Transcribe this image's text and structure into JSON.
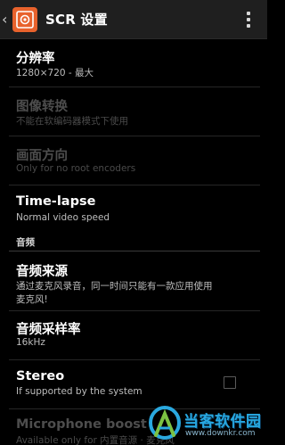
{
  "actionbar": {
    "back_glyph": "‹",
    "title": "SCR 设置",
    "icon": "screen-recorder-app-icon",
    "menu_icon": "overflow-menu-icon"
  },
  "prefs": {
    "resolution": {
      "title": "分辨率",
      "summary": "1280×720 - 最大"
    },
    "image_transform": {
      "title": "图像转换",
      "summary": "不能在软编码器模式下使用"
    },
    "orientation": {
      "title": "画面方向",
      "summary": "Only for no root encoders"
    },
    "timelapse": {
      "title": "Time-lapse",
      "summary": "Normal video speed"
    }
  },
  "audio_category": {
    "label": "音频"
  },
  "audio_prefs": {
    "source": {
      "title": "音频来源",
      "summary_line1": "通过麦克风录音，同一时间只能有一款应用使用",
      "summary_line2": "麦克风!"
    },
    "sample_rate": {
      "title": "音频采样率",
      "summary": "16kHz"
    },
    "stereo": {
      "title": "Stereo",
      "summary": "If supported by the system",
      "checked": false
    },
    "mic_boost": {
      "title": "Microphone boost",
      "summary": "Available only for 内置音源 · 麦克风"
    }
  },
  "watermark": {
    "title": "当客软件园",
    "url": "www.downkr.com",
    "logo": "downkr-logo-icon"
  }
}
